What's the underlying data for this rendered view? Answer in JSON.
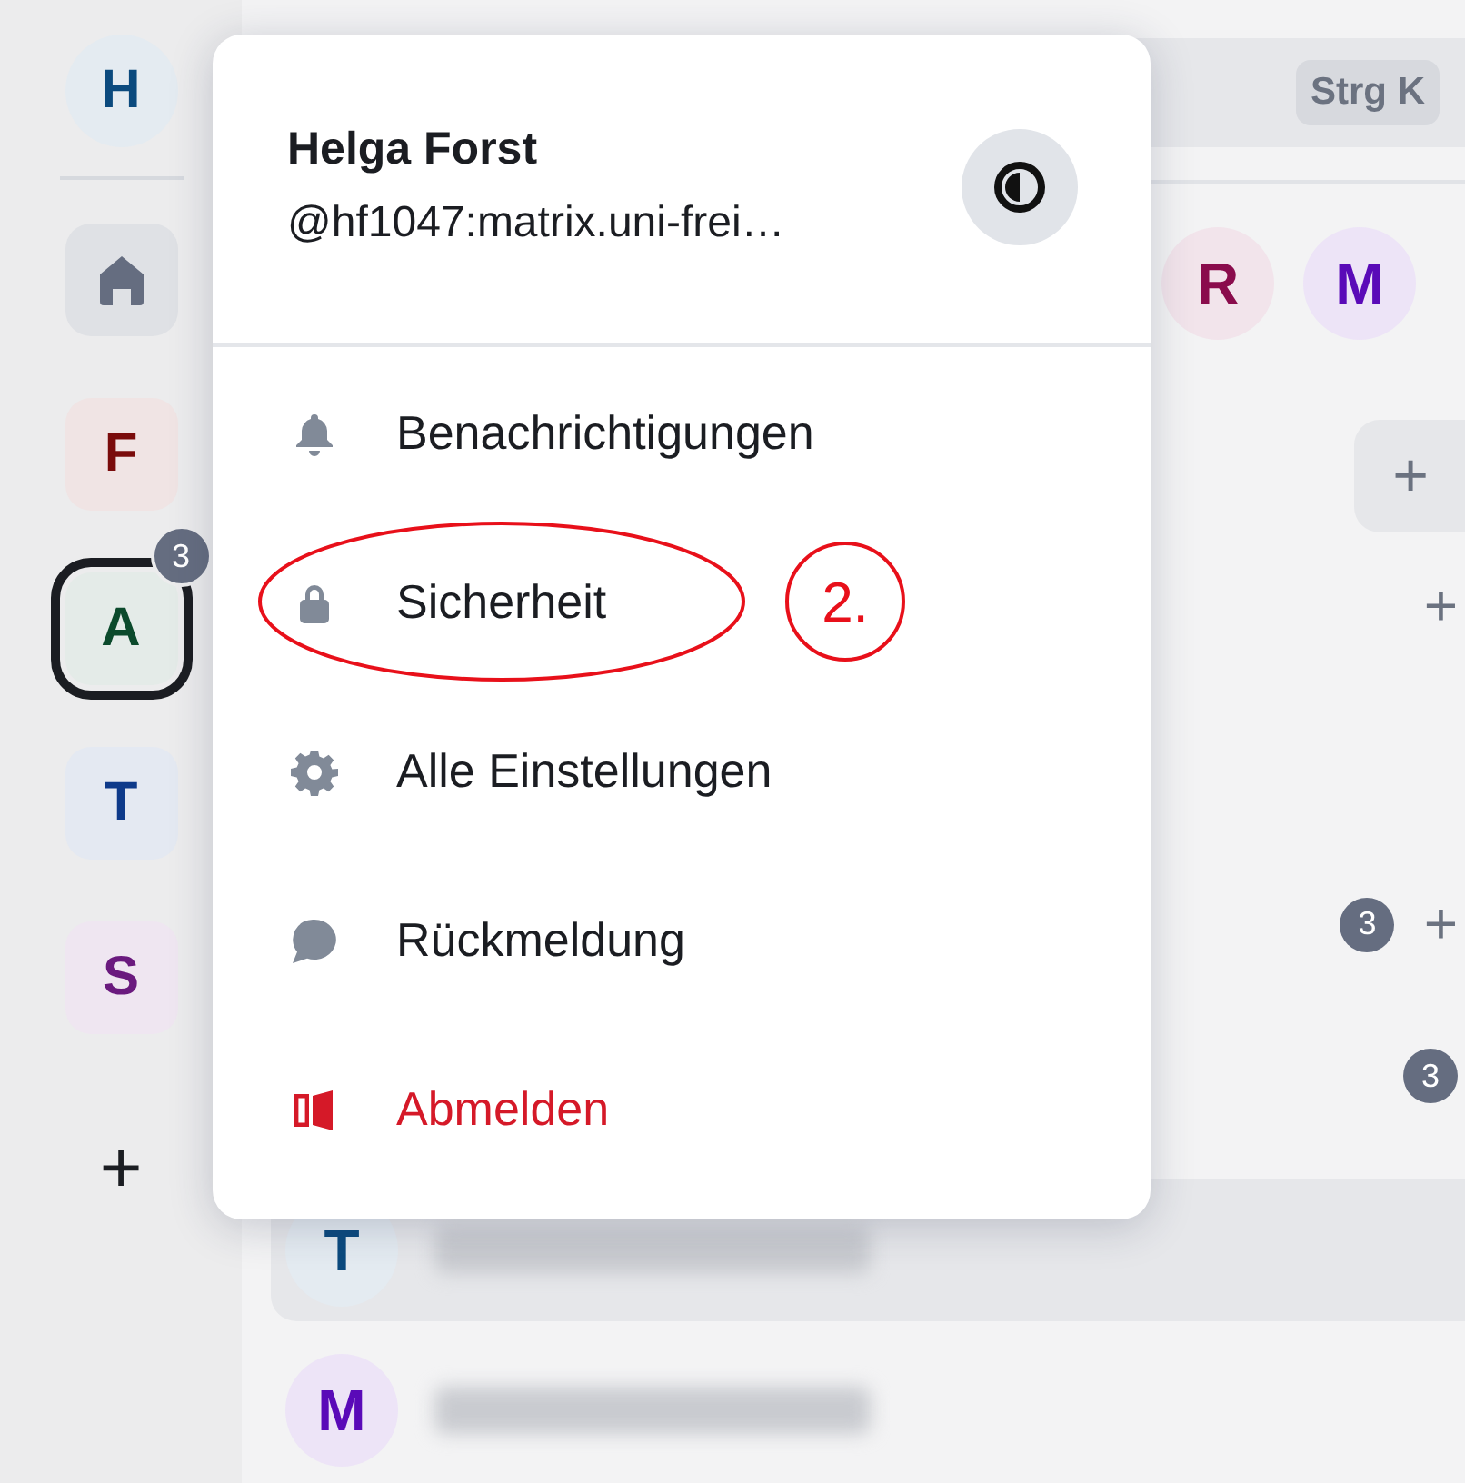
{
  "spaces": [
    {
      "kind": "avatar",
      "letter": "H",
      "color": "#0b4a7e"
    },
    {
      "kind": "home"
    },
    {
      "kind": "space",
      "letter": "F",
      "color": "#7a0c0c",
      "selected": false
    },
    {
      "kind": "space",
      "letter": "A",
      "color": "#0b4a2c",
      "selected": true,
      "badge": "3"
    },
    {
      "kind": "space",
      "letter": "T",
      "color": "#0e3a8a",
      "selected": false
    },
    {
      "kind": "space",
      "letter": "S",
      "color": "#6a1a7e",
      "selected": false
    },
    {
      "kind": "add",
      "label": "+"
    }
  ],
  "menu": {
    "name": "Helga Forst",
    "handle": "@hf1047:matrix.uni-frei…",
    "items": [
      {
        "label": "Benachrichtigungen",
        "kind": "notifications"
      },
      {
        "label": "Sicherheit",
        "kind": "security"
      },
      {
        "label": "Alle Einstellungen",
        "kind": "settings"
      },
      {
        "label": "Rückmeldung",
        "kind": "feedback"
      },
      {
        "label": "Abmelden",
        "kind": "logout"
      }
    ]
  },
  "annotation": {
    "label": "2."
  },
  "main": {
    "shortcut": "Strg K",
    "people": [
      {
        "letter": "R",
        "color": "#8a0c4c"
      },
      {
        "letter": "M",
        "color": "#5a0ab8"
      }
    ],
    "add_button": "+",
    "add_label": "+",
    "unread_badge": "3",
    "unread_add": "+",
    "second_badge": "3",
    "rooms": [
      {
        "letter": "T",
        "color": "#0b4a7e",
        "selected": true
      },
      {
        "letter": "M",
        "color": "#5a0ab8",
        "selected": false
      }
    ]
  }
}
